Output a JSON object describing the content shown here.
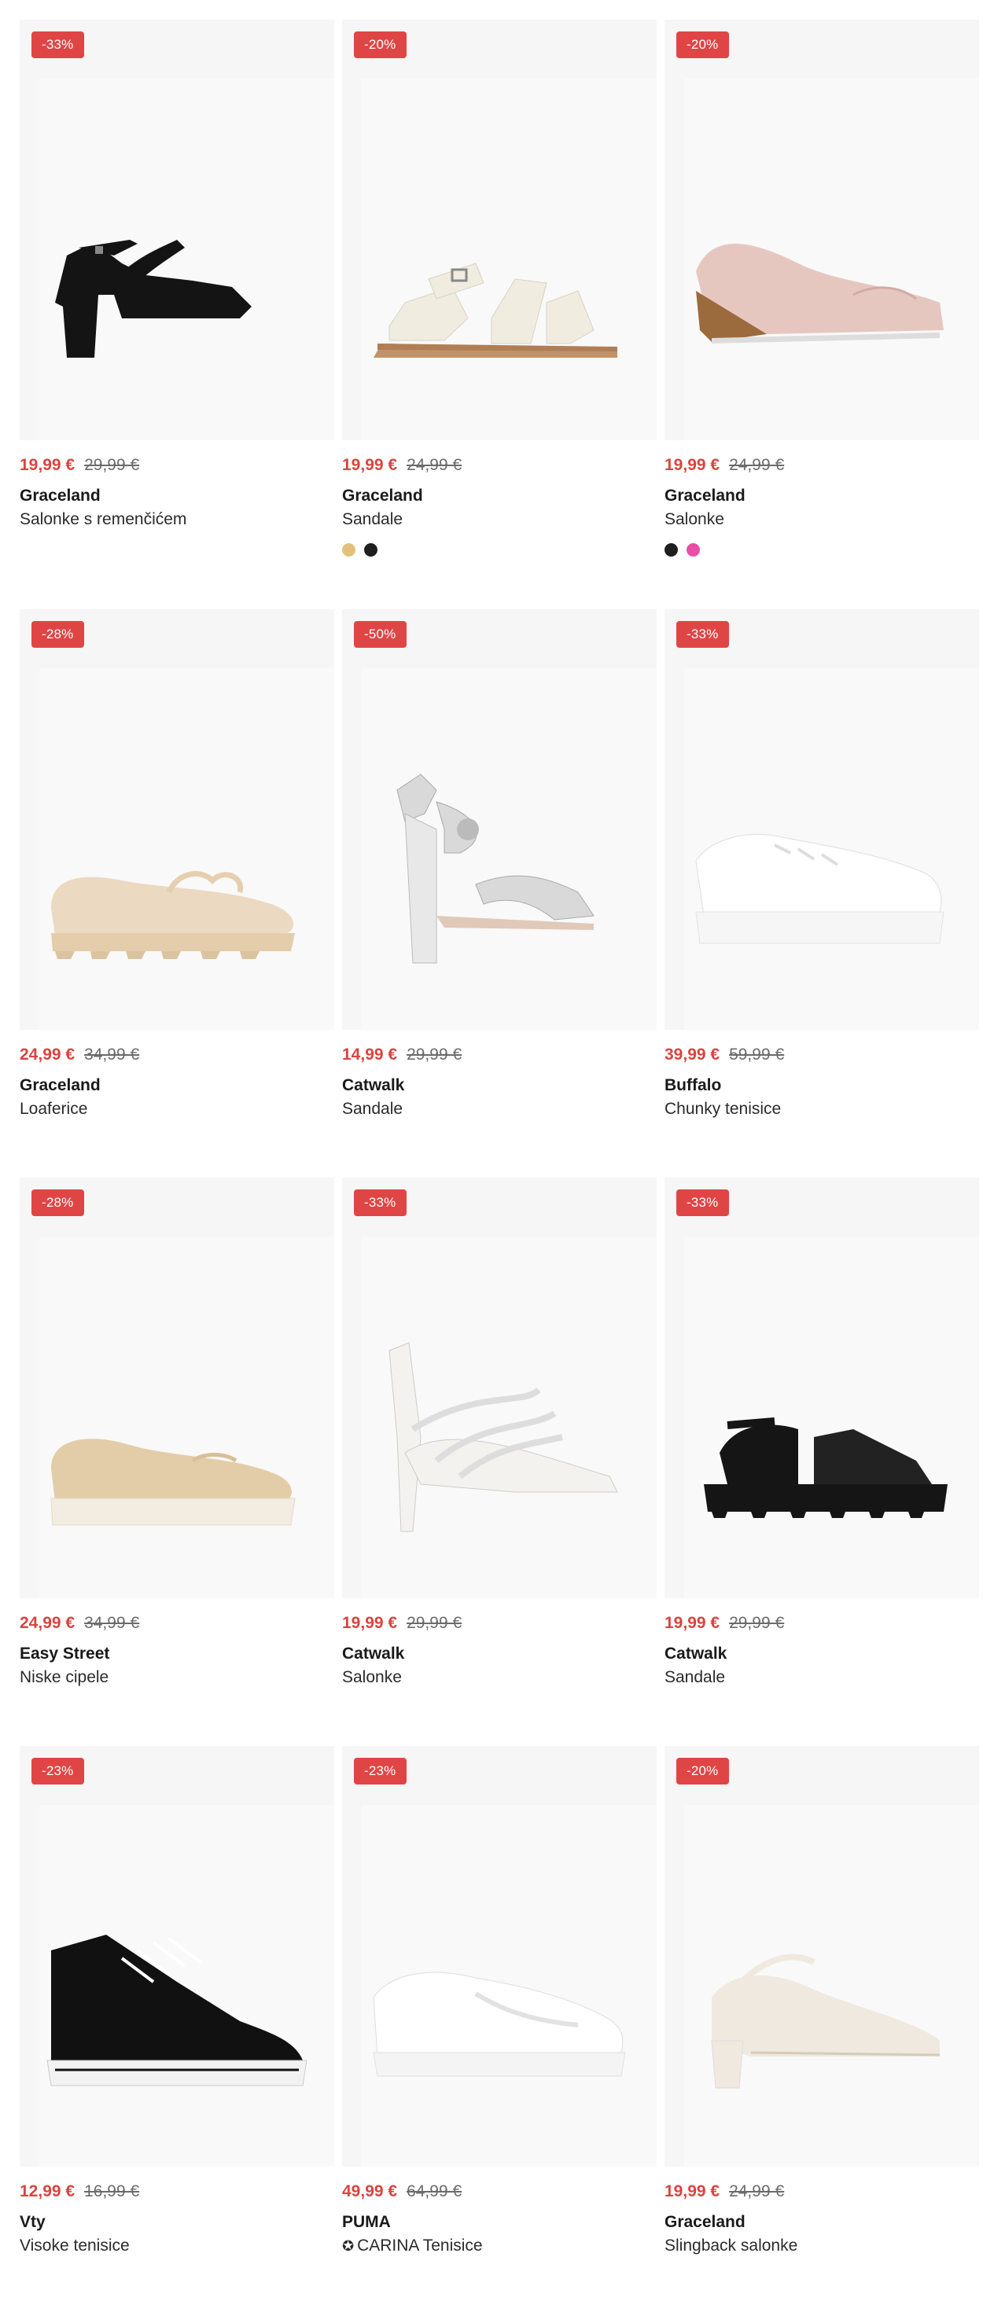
{
  "products": [
    {
      "discount": "-33%",
      "price": "19,99 €",
      "old_price": "29,99 €",
      "brand": "Graceland",
      "name": "Salonke s remenčićem",
      "swatches": [],
      "shoe": "heel-strap",
      "shoe_color": "#141414"
    },
    {
      "discount": "-20%",
      "price": "19,99 €",
      "old_price": "24,99 €",
      "brand": "Graceland",
      "name": "Sandale",
      "swatches": [
        "#e2c27a",
        "#1e1e1e"
      ],
      "shoe": "flat-sandal",
      "shoe_color": "#f1ece0"
    },
    {
      "discount": "-20%",
      "price": "19,99 €",
      "old_price": "24,99 €",
      "brand": "Graceland",
      "name": "Salonke",
      "swatches": [
        "#1e1e1e",
        "#e84fa5"
      ],
      "shoe": "wedge",
      "shoe_color": "#e6c7c0"
    },
    {
      "discount": "-28%",
      "price": "24,99 €",
      "old_price": "34,99 €",
      "brand": "Graceland",
      "name": "Loaferice",
      "swatches": [],
      "shoe": "loafer",
      "shoe_color": "#ecd9c2"
    },
    {
      "discount": "-50%",
      "price": "14,99 €",
      "old_price": "29,99 €",
      "brand": "Catwalk",
      "name": "Sandale",
      "swatches": [],
      "shoe": "high-sandal",
      "shoe_color": "#d9d9d9"
    },
    {
      "discount": "-33%",
      "price": "39,99 €",
      "old_price": "59,99 €",
      "brand": "Buffalo",
      "name": "Chunky tenisice",
      "swatches": [],
      "shoe": "chunky-sneaker",
      "shoe_color": "#ffffff"
    },
    {
      "discount": "-28%",
      "price": "24,99 €",
      "old_price": "34,99 €",
      "brand": "Easy Street",
      "name": "Niske cipele",
      "swatches": [],
      "shoe": "wedge-loafer",
      "shoe_color": "#e3cda8"
    },
    {
      "discount": "-33%",
      "price": "19,99 €",
      "old_price": "29,99 €",
      "brand": "Catwalk",
      "name": "Salonke",
      "swatches": [],
      "shoe": "strappy-pump",
      "shoe_color": "#f4f2ee"
    },
    {
      "discount": "-33%",
      "price": "19,99 €",
      "old_price": "29,99 €",
      "brand": "Catwalk",
      "name": "Sandale",
      "swatches": [],
      "shoe": "platform-sandal",
      "shoe_color": "#151515"
    },
    {
      "discount": "-23%",
      "price": "12,99 €",
      "old_price": "16,99 €",
      "brand": "Vty",
      "name": "Visoke tenisice",
      "swatches": [],
      "shoe": "hightop",
      "shoe_color": "#111111"
    },
    {
      "discount": "-23%",
      "price": "49,99 €",
      "old_price": "64,99 €",
      "brand": "PUMA",
      "name": "CARINA Tenisice",
      "name_icon": "✪",
      "swatches": [],
      "shoe": "sneaker",
      "shoe_color": "#ffffff"
    },
    {
      "discount": "-20%",
      "price": "19,99 €",
      "old_price": "24,99 €",
      "brand": "Graceland",
      "name": "Slingback salonke",
      "swatches": [],
      "shoe": "slingback",
      "shoe_color": "#efe9df"
    }
  ],
  "colors": {
    "accent": "#d9443f",
    "badge_bg": "#e04545",
    "tile_bg": "#f6f6f6"
  }
}
